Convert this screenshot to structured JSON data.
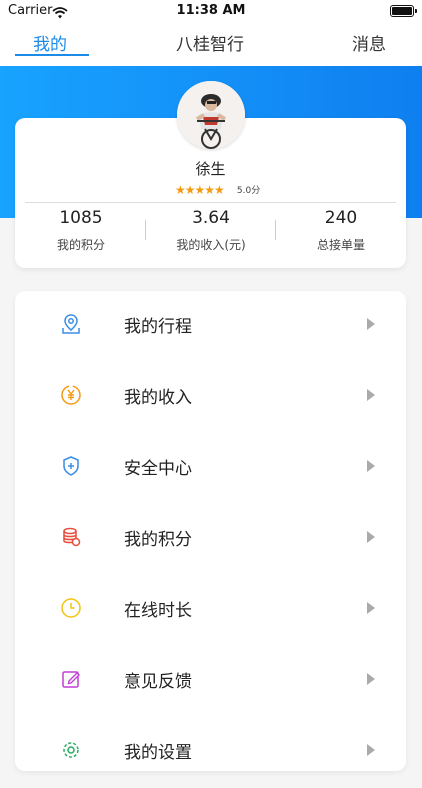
{
  "status": {
    "carrier": "Carrier",
    "time": "11:38 AM"
  },
  "tabs": [
    {
      "label": "我的",
      "active": true
    },
    {
      "label": "八桂智行",
      "active": false
    },
    {
      "label": "消息",
      "active": false
    }
  ],
  "profile": {
    "name": "徐生",
    "stars": "★★★★★",
    "rating_text": "5.0分",
    "rating": 5.0
  },
  "stats": [
    {
      "value": "1085",
      "label": "我的积分"
    },
    {
      "value": "3.64",
      "label": "我的收入(元)"
    },
    {
      "value": "240",
      "label": "总接单量"
    }
  ],
  "menu": [
    {
      "label": "我的行程",
      "icon": "location-icon",
      "color": "#3a8ee6"
    },
    {
      "label": "我的收入",
      "icon": "yuan-coin-icon",
      "color": "#f39c12"
    },
    {
      "label": "安全中心",
      "icon": "shield-icon",
      "color": "#3a8ee6"
    },
    {
      "label": "我的积分",
      "icon": "coins-stack-icon",
      "color": "#e74c3c"
    },
    {
      "label": "在线时长",
      "icon": "clock-icon",
      "color": "#f1c40f"
    },
    {
      "label": "意见反馈",
      "icon": "edit-icon",
      "color": "#c23fd3"
    },
    {
      "label": "我的设置",
      "icon": "gear-icon",
      "color": "#27ae60"
    }
  ],
  "colors": {
    "accent": "#1c8ae7",
    "header_start": "#18a3ff",
    "header_end": "#0f7ff0"
  }
}
